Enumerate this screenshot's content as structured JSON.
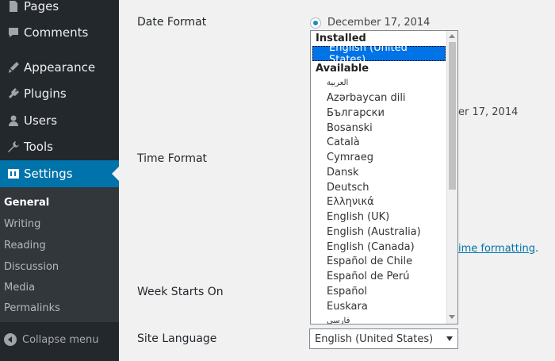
{
  "sidebar": {
    "items": [
      {
        "label": "Pages",
        "icon": "pages-icon"
      },
      {
        "label": "Comments",
        "icon": "comments-icon"
      },
      {
        "label": "Appearance",
        "icon": "appearance-icon"
      },
      {
        "label": "Plugins",
        "icon": "plugins-icon"
      },
      {
        "label": "Users",
        "icon": "users-icon"
      },
      {
        "label": "Tools",
        "icon": "tools-icon"
      },
      {
        "label": "Settings",
        "icon": "settings-icon"
      }
    ],
    "submenu": [
      "General",
      "Writing",
      "Reading",
      "Discussion",
      "Media",
      "Permalinks"
    ],
    "collapse_label": "Collapse menu"
  },
  "settings": {
    "date_format_label": "Date Format",
    "date_option_1": "December 17, 2014",
    "date_option_partial": "er 17, 2014",
    "time_format_label": "Time Format",
    "time_link": "ime formatting",
    "time_link_suffix": ".",
    "week_label": "Week Starts On",
    "site_language_label": "Site Language",
    "site_language_value": "English (United States)"
  },
  "dropdown": {
    "installed_label": "Installed",
    "installed": [
      "English (United States)"
    ],
    "available_label": "Available",
    "available": [
      "العربية",
      "Azərbaycan dili",
      "Български",
      "Bosanski",
      "Català",
      "Cymraeg",
      "Dansk",
      "Deutsch",
      "Ελληνικά",
      "English (UK)",
      "English (Australia)",
      "English (Canada)",
      "Español de Chile",
      "Español de Perú",
      "Español",
      "Euskara",
      "فارسی"
    ]
  },
  "colors": {
    "sidebar_bg": "#23282d",
    "accent": "#0073aa",
    "selection": "#0073e6"
  }
}
